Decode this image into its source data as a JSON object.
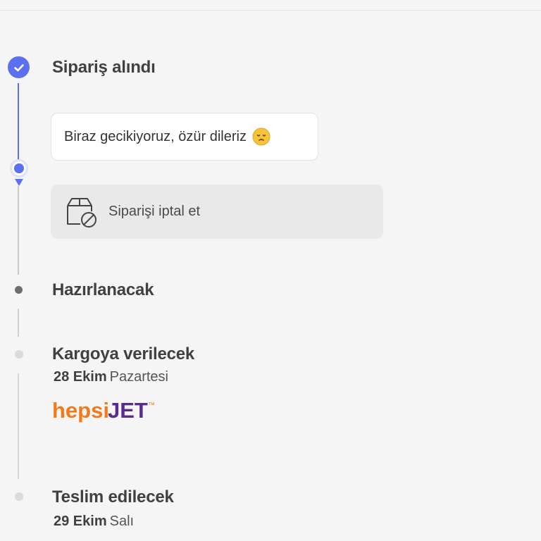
{
  "timeline": {
    "steps": [
      {
        "title": "Sipariş alındı",
        "status": "completed"
      },
      {
        "title": "Hazırlanacak",
        "status": "pending"
      },
      {
        "title": "Kargoya verilecek",
        "status": "upcoming",
        "date": "28 Ekim",
        "weekday": "Pazartesi"
      },
      {
        "title": "Teslim edilecek",
        "status": "upcoming",
        "date": "29 Ekim",
        "weekday": "Salı"
      }
    ]
  },
  "delay_notice": {
    "text": "Biraz gecikiyoruz, özür dileriz",
    "emoji": "sad-face-emoji"
  },
  "cancel_action": {
    "label": "Siparişi iptal et",
    "icon": "box-cancel-icon"
  },
  "carrier": {
    "logo_part1": "hepsi",
    "logo_part2": "JET",
    "logo_mark": "™"
  },
  "colors": {
    "accent": "#5c6ff0",
    "background": "#f5f5f5",
    "logo_orange": "#f27a1a",
    "logo_purple": "#5b2b8c"
  }
}
